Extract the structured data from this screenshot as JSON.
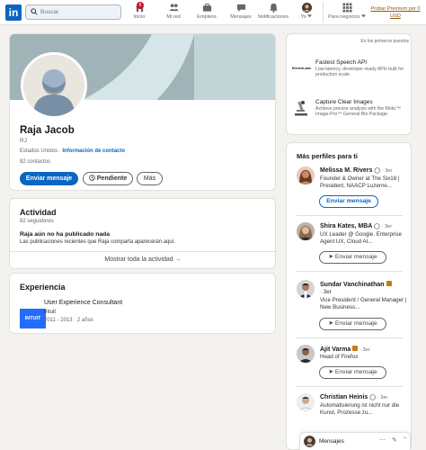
{
  "nav": {
    "search_placeholder": "Buscar",
    "items": [
      {
        "label": "Inicio",
        "badge": "8"
      },
      {
        "label": "Mi red"
      },
      {
        "label": "Empleos"
      },
      {
        "label": "Mensajes"
      },
      {
        "label": "Notificaciones"
      },
      {
        "label": "Yo"
      },
      {
        "label": "Para negocios"
      }
    ],
    "premium": "Probar Premium por 0 USD"
  },
  "profile": {
    "name": "Raja Jacob",
    "initials": "RJ",
    "location": "Estados Unidos",
    "separator": "·",
    "contact_link": "Información de contacto",
    "contacts": "82 contactos",
    "buttons": {
      "message": "Enviar mensaje",
      "pending": "Pendiente",
      "more": "Más"
    }
  },
  "activity": {
    "title": "Actividad",
    "followers": "82 seguidores",
    "empty_title": "Raja aún no ha publicado nada",
    "empty_desc": "Las publicaciones recientes que Raja comparta aparecerán aquí.",
    "show_all": "Mostrar toda la actividad"
  },
  "experience": {
    "title": "Experiencia",
    "items": [
      {
        "logo": "INTUIT",
        "role": "User Experience Consultant",
        "company": "Intuit",
        "dates": "2011 - 2013 · 2 años"
      }
    ]
  },
  "ads": {
    "label": "En los primeros puestos",
    "items": [
      {
        "logo": "ElevenLabs",
        "title": "Fastest Speech API",
        "desc": "Low-latency, developer-ready APIs built for production scale."
      },
      {
        "title": "Capture Clear Images",
        "desc": "Achieve precise analysis with the Motic™ Image-Pro™ General Bio Package."
      }
    ]
  },
  "people": {
    "title": "Más perfiles para ti",
    "items": [
      {
        "name": "Melissa M. Rivers",
        "degree": "· 3er",
        "headline": "Founder & Owner at The Six18 | President, NAACP Luzerne...",
        "button": "Enviar mensaje"
      },
      {
        "name": "Shira Kates, MBA",
        "degree": "· 3er",
        "headline": "UX Leader @ Google. Enterprise Agent UX, Cloud AI...",
        "button": "Enviar mensaje"
      },
      {
        "name": "Sundar Vanchinathan",
        "degree": "· 3er",
        "headline": "Vice President / General Manager | New Business...",
        "button": "Enviar mensaje"
      },
      {
        "name": "Ajit Varma",
        "degree": "· 3er",
        "headline": "Head of Firefox",
        "button": "Enviar mensaje"
      },
      {
        "name": "Christian Heinis",
        "degree": "· 3er",
        "headline": "Automatisierung ist nicht nur die Kunst, Prozesse zu..."
      }
    ]
  },
  "messaging": {
    "label": "Mensajes"
  },
  "colors": {
    "brand": "#0a66c2",
    "background": "#f4f2ee",
    "premium": "#915907"
  }
}
